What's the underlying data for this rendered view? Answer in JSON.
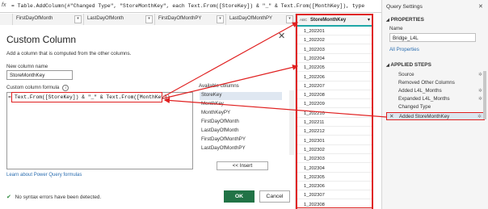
{
  "formula_bar": {
    "fx": "fx",
    "text": "= Table.AddColumn(#\"Changed Type\", \"StoreMonthKey\", each Text.From([StoreKey]) & \"_\" & Text.From([MonthKey]), type text)"
  },
  "columns": [
    "FirstDayOfMonth",
    "LastDayOfMonth",
    "FirstDayOfMonthPY",
    "LastDayOfMonthPY"
  ],
  "dialog": {
    "title": "Custom Column",
    "close": "✕",
    "description": "Add a column that is computed from the other columns.",
    "new_col_label": "New column name",
    "new_col_value": "StoreMonthKey",
    "formula_label": "Custom column formula",
    "formula_prefix": "=",
    "formula": "Text.From([StoreKey]) & \"_\" & Text.From([MonthKey])",
    "available_label": "Available columns",
    "available": [
      "StoreKey",
      "MonthKey",
      "MonthKeyPY",
      "FirstDayOfMonth",
      "LastDayOfMonth",
      "FirstDayOfMonthPY",
      "LastDayOfMonthPY"
    ],
    "insert": "<< Insert",
    "learn": "Learn about Power Query formulas",
    "status": "No syntax errors have been detected.",
    "ok": "OK",
    "cancel": "Cancel"
  },
  "new_column": {
    "header": "StoreMonthKey",
    "type_icon": "ABC",
    "values": [
      "1_202201",
      "1_202202",
      "1_202203",
      "1_202204",
      "1_202205",
      "1_202206",
      "1_202207",
      "1_202208",
      "1_202209",
      "1_202210",
      "1_202211",
      "1_202212",
      "1_202301",
      "1_202302",
      "1_202303",
      "1_202304",
      "1_202305",
      "1_202306",
      "1_202307",
      "1_202308"
    ]
  },
  "query_settings": {
    "title": "Query Settings",
    "close": "✕",
    "properties": "PROPERTIES",
    "name_label": "Name",
    "name_value": "Bridge_L4L",
    "all_properties": "All Properties",
    "applied_steps": "APPLIED STEPS",
    "steps": [
      "Source",
      "Removed Other Columns",
      "Added L4L_Months",
      "Expanded L4L_Months",
      "Changed Type",
      "Added StoreMonthKey"
    ]
  },
  "colors": {
    "accent_red": "#e02020",
    "ok_green": "#217346",
    "key_teal": "#1fa7a7",
    "link_blue": "#2a6db0"
  }
}
